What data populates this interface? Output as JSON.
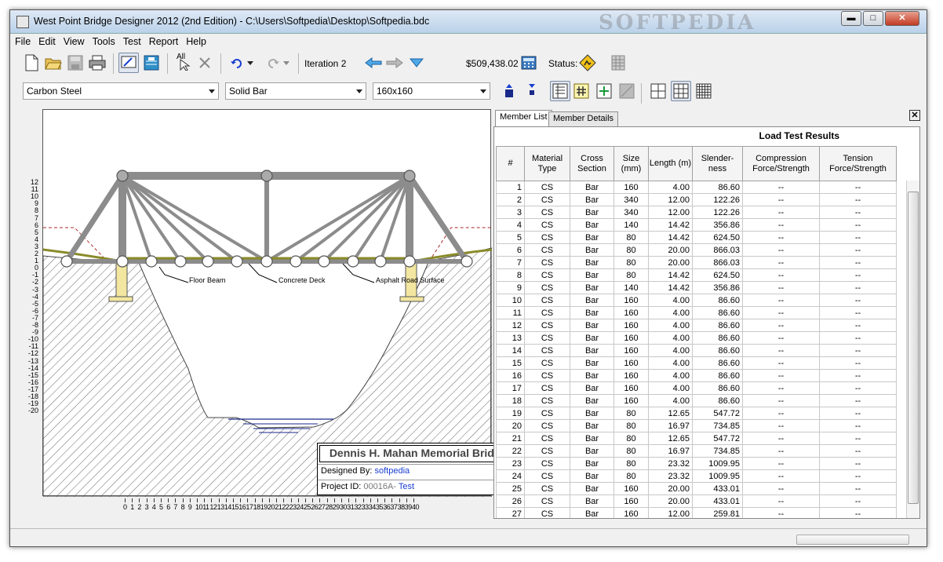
{
  "window": {
    "title": "West Point Bridge Designer 2012 (2nd Edition) - C:\\Users\\Softpedia\\Desktop\\Softpedia.bdc",
    "watermark": "SOFTPEDIA",
    "minimize": "▬",
    "maximize": "□",
    "close": "✕"
  },
  "menu": [
    "File",
    "Edit",
    "View",
    "Tools",
    "Test",
    "Report",
    "Help"
  ],
  "toolbar": {
    "iteration_label": "Iteration 2",
    "cost": "$509,438.02",
    "status_label": "Status:",
    "auto_label": "All",
    "status_icon": "warning-sign"
  },
  "selectors": {
    "material": "Carbon Steel",
    "section": "Solid Bar",
    "size": "160x160"
  },
  "drawing": {
    "y_ticks": [
      "12",
      "11",
      "10",
      "9",
      "8",
      "7",
      "6",
      "5",
      "4",
      "3",
      "2",
      "1",
      "0",
      "-1",
      "-2",
      "-3",
      "-4",
      "-5",
      "-6",
      "-7",
      "-8",
      "-9",
      "-10",
      "-11",
      "-12",
      "-13",
      "-14",
      "-15",
      "-16",
      "-17",
      "-18",
      "-19",
      "-20"
    ],
    "x_ticks": [
      "0",
      "1",
      "2",
      "3",
      "4",
      "5",
      "6",
      "7",
      "8",
      "9",
      "10",
      "11",
      "12",
      "13",
      "14",
      "15",
      "16",
      "17",
      "18",
      "19",
      "20",
      "21",
      "22",
      "23",
      "24",
      "25",
      "26",
      "27",
      "28",
      "29",
      "30",
      "31",
      "32",
      "33",
      "34",
      "35",
      "36",
      "37",
      "38",
      "39",
      "40"
    ],
    "callouts": {
      "floor_beam": "Floor Beam",
      "concrete_deck": "Concrete Deck",
      "asphalt": "Asphalt Road Surface"
    },
    "titleblock": {
      "bridge_name": "Dennis H. Mahan Memorial Bridge",
      "designed_by_label": "Designed By:",
      "designed_by": "softpedia",
      "project_id_label": "Project ID:",
      "project_id_prefix": "00016A-",
      "project_id_value": "Test"
    }
  },
  "panel": {
    "tabs": [
      "Member List",
      "Member Details"
    ],
    "close": "✕",
    "results_title": "Load Test Results",
    "columns": [
      "#",
      "Material Type",
      "Cross Section",
      "Size (mm)",
      "Length (m)",
      "Slender- ness",
      "Compression Force/Strength",
      "Tension Force/Strength"
    ],
    "rows": [
      [
        "1",
        "CS",
        "Bar",
        "160",
        "4.00",
        "86.60",
        "--",
        "--"
      ],
      [
        "2",
        "CS",
        "Bar",
        "340",
        "12.00",
        "122.26",
        "--",
        "--"
      ],
      [
        "3",
        "CS",
        "Bar",
        "340",
        "12.00",
        "122.26",
        "--",
        "--"
      ],
      [
        "4",
        "CS",
        "Bar",
        "140",
        "14.42",
        "356.86",
        "--",
        "--"
      ],
      [
        "5",
        "CS",
        "Bar",
        "80",
        "14.42",
        "624.50",
        "--",
        "--"
      ],
      [
        "6",
        "CS",
        "Bar",
        "80",
        "20.00",
        "866.03",
        "--",
        "--"
      ],
      [
        "7",
        "CS",
        "Bar",
        "80",
        "20.00",
        "866.03",
        "--",
        "--"
      ],
      [
        "8",
        "CS",
        "Bar",
        "80",
        "14.42",
        "624.50",
        "--",
        "--"
      ],
      [
        "9",
        "CS",
        "Bar",
        "140",
        "14.42",
        "356.86",
        "--",
        "--"
      ],
      [
        "10",
        "CS",
        "Bar",
        "160",
        "4.00",
        "86.60",
        "--",
        "--"
      ],
      [
        "11",
        "CS",
        "Bar",
        "160",
        "4.00",
        "86.60",
        "--",
        "--"
      ],
      [
        "12",
        "CS",
        "Bar",
        "160",
        "4.00",
        "86.60",
        "--",
        "--"
      ],
      [
        "13",
        "CS",
        "Bar",
        "160",
        "4.00",
        "86.60",
        "--",
        "--"
      ],
      [
        "14",
        "CS",
        "Bar",
        "160",
        "4.00",
        "86.60",
        "--",
        "--"
      ],
      [
        "15",
        "CS",
        "Bar",
        "160",
        "4.00",
        "86.60",
        "--",
        "--"
      ],
      [
        "16",
        "CS",
        "Bar",
        "160",
        "4.00",
        "86.60",
        "--",
        "--"
      ],
      [
        "17",
        "CS",
        "Bar",
        "160",
        "4.00",
        "86.60",
        "--",
        "--"
      ],
      [
        "18",
        "CS",
        "Bar",
        "160",
        "4.00",
        "86.60",
        "--",
        "--"
      ],
      [
        "19",
        "CS",
        "Bar",
        "80",
        "12.65",
        "547.72",
        "--",
        "--"
      ],
      [
        "20",
        "CS",
        "Bar",
        "80",
        "16.97",
        "734.85",
        "--",
        "--"
      ],
      [
        "21",
        "CS",
        "Bar",
        "80",
        "12.65",
        "547.72",
        "--",
        "--"
      ],
      [
        "22",
        "CS",
        "Bar",
        "80",
        "16.97",
        "734.85",
        "--",
        "--"
      ],
      [
        "23",
        "CS",
        "Bar",
        "80",
        "23.32",
        "1009.95",
        "--",
        "--"
      ],
      [
        "24",
        "CS",
        "Bar",
        "80",
        "23.32",
        "1009.95",
        "--",
        "--"
      ],
      [
        "25",
        "CS",
        "Bar",
        "160",
        "20.00",
        "433.01",
        "--",
        "--"
      ],
      [
        "26",
        "CS",
        "Bar",
        "160",
        "20.00",
        "433.01",
        "--",
        "--"
      ],
      [
        "27",
        "CS",
        "Bar",
        "160",
        "12.00",
        "259.81",
        "--",
        "--"
      ]
    ]
  },
  "colors": {
    "member": "#8c8c8c",
    "deck": "#8a8a2a",
    "water": "#1a2a8a",
    "ground_hatch": "#555555"
  }
}
